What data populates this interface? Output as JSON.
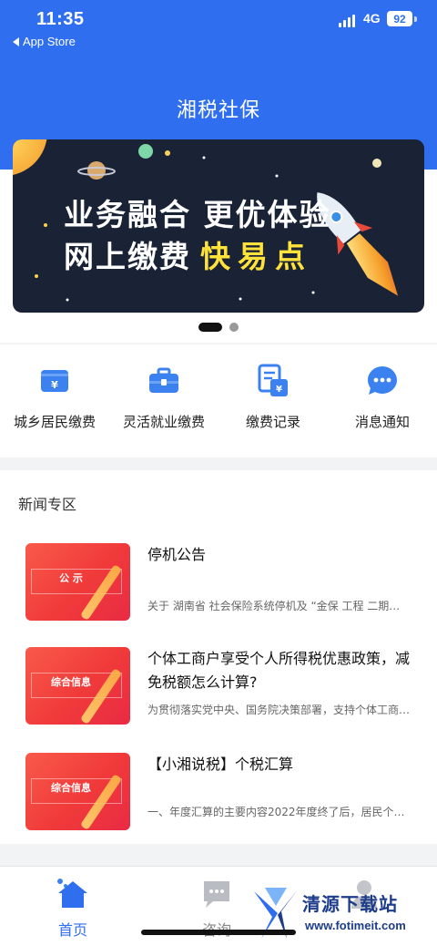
{
  "status_bar": {
    "time": "11:35",
    "back_label": "App Store",
    "network": "4G",
    "battery": "92"
  },
  "header": {
    "title": "湘税社保"
  },
  "banner": {
    "line1": "业务融合 更优体验",
    "line2_prefix": "网上缴费",
    "line2_highlight": "快易点",
    "page_count": 2,
    "active_index": 0
  },
  "quick_actions": [
    {
      "label": "城乡居民缴费",
      "icon": "yuan-card-icon"
    },
    {
      "label": "灵活就业缴费",
      "icon": "briefcase-icon"
    },
    {
      "label": "缴费记录",
      "icon": "record-document-icon"
    },
    {
      "label": "消息通知",
      "icon": "chat-bubble-icon"
    }
  ],
  "news": {
    "section_title": "新闻专区",
    "items": [
      {
        "title": "停机公告",
        "summary": "关于 湖南省 社会保险系统停机及 “金保 工程 二期…",
        "thumb_tag": "公 示",
        "thumb_sub": ""
      },
      {
        "title": "个体工商户享受个人所得税优惠政策，减免税额怎么计算?",
        "summary": "为贯彻落实党中央、国务院决策部署，支持个体工商…",
        "thumb_tag": "综合信息",
        "thumb_sub": ""
      },
      {
        "title": "【小湘说税】个税汇算",
        "summary": "一、年度汇算的主要内容2022年度终了后，居民个…",
        "thumb_tag": "综合信息",
        "thumb_sub": ""
      }
    ]
  },
  "tabbar": {
    "items": [
      {
        "label": "首页",
        "icon": "home-icon",
        "active": true
      },
      {
        "label": "咨询",
        "icon": "chat-icon",
        "active": false
      },
      {
        "label": "",
        "icon": "person-icon",
        "active": false
      }
    ]
  },
  "watermark": {
    "text": "清源下载站",
    "url": "www.fotimeit.com"
  },
  "colors": {
    "brand_blue": "#2f6fef",
    "highlight_yellow": "#ffe23a",
    "news_red": "#f03a3a"
  }
}
